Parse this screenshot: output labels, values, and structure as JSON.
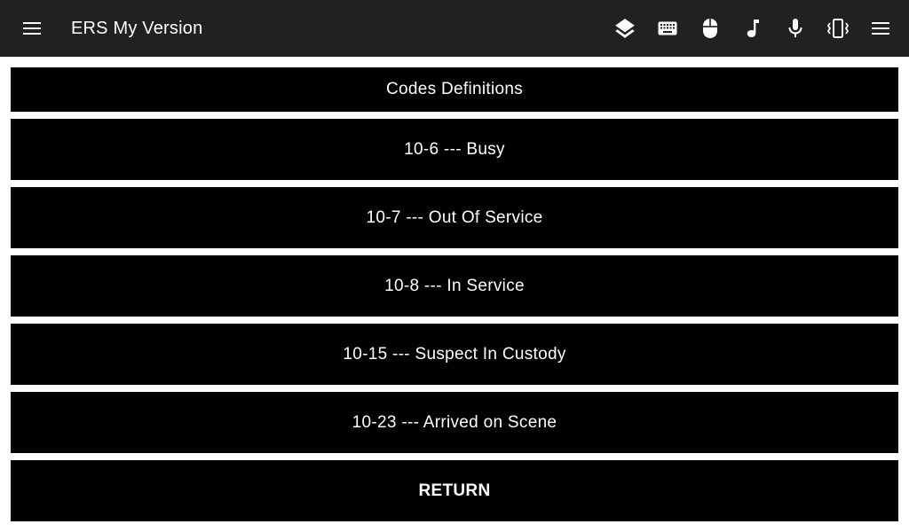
{
  "appbar": {
    "title": "ERS My Version",
    "icons": [
      "menu-icon",
      "layers-icon",
      "keyboard-icon",
      "mouse-icon",
      "music-note-icon",
      "microphone-icon",
      "vibrate-icon",
      "overflow-menu-icon"
    ]
  },
  "colors": {
    "appbar_bg": "#212121",
    "panel_bg": "#000000",
    "text": "#ffffff",
    "page_bg": "#ffffff"
  },
  "main": {
    "header": "Codes Definitions",
    "codes": [
      {
        "label": "10-6 --- Busy"
      },
      {
        "label": "10-7 --- Out Of Service"
      },
      {
        "label": "10-8 --- In Service"
      },
      {
        "label": "10-15 --- Suspect In Custody"
      },
      {
        "label": "10-23 --- Arrived on Scene"
      }
    ],
    "return_label": "RETURN"
  }
}
